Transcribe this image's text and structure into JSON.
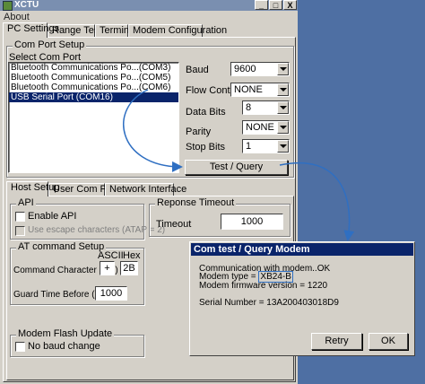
{
  "window": {
    "title": "XCTU",
    "menu_about": "About",
    "min": "_",
    "max": "□",
    "close": "X"
  },
  "tabs": [
    "PC Settings",
    "Range Test",
    "Terminal",
    "Modem Configuration"
  ],
  "com_setup": {
    "title": "Com Port Setup",
    "select_label": "Select Com Port",
    "ports": [
      "Bluetooth Communications Po...(COM3)",
      "Bluetooth Communications Po...(COM5)",
      "Bluetooth Communications Po...(COM6)",
      "USB Serial Port (COM16)"
    ],
    "selected_index": 3,
    "baud_label": "Baud",
    "baud_value": "9600",
    "flow_label": "Flow Control",
    "flow_value": "NONE",
    "databits_label": "Data Bits",
    "databits_value": "8",
    "parity_label": "Parity",
    "parity_value": "NONE",
    "stopbits_label": "Stop Bits",
    "stopbits_value": "1",
    "test_button": "Test / Query"
  },
  "subtabs": [
    "Host Setup",
    "User Com Ports",
    "Network Interface"
  ],
  "api": {
    "title": "API",
    "enable": "Enable API",
    "escape": "Use escape characters (ATAP = 2)"
  },
  "timeout": {
    "title": "Reponse Timeout",
    "label": "Timeout",
    "value": "1000"
  },
  "at": {
    "title": "AT command Setup",
    "ascii": "ASCII",
    "hex": "Hex",
    "cc_label": "Command Character (CC)",
    "cc_ascii": "+",
    "cc_hex": "2B",
    "gt_label": "Guard Time Before (BT)",
    "gt_value": "1000"
  },
  "flash": {
    "title": "Modem Flash Update",
    "no_baud": "No baud change"
  },
  "dialog": {
    "title": "Com test / Query Modem",
    "line1": "Communication with modem..OK",
    "modem_type_label": "Modem type = ",
    "modem_type_value": "XB24-B",
    "line3": "Modem firmware version = 1220",
    "serial": "Serial Number = 13A200403018D9",
    "retry": "Retry",
    "ok": "OK"
  },
  "colors": {
    "desktop": "#4e6fa3",
    "face": "#d4d0c8",
    "selection": "#0a246a",
    "arrow": "#2f6fc2"
  }
}
